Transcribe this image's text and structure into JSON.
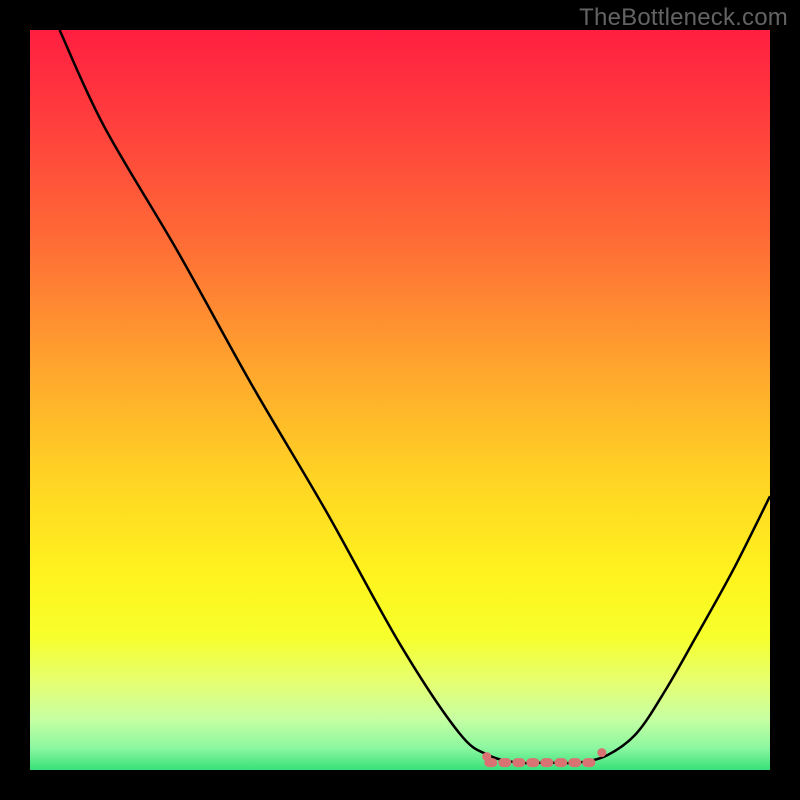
{
  "watermark": "TheBottleneck.com",
  "chart_data": {
    "type": "line",
    "title": "",
    "xlabel": "",
    "ylabel": "",
    "xlim": [
      0,
      100
    ],
    "ylim": [
      0,
      100
    ],
    "grid": false,
    "series": [
      {
        "name": "curve",
        "color": "#000000",
        "x": [
          4,
          10,
          20,
          30,
          40,
          50,
          58,
          62,
          66,
          70,
          74,
          78,
          82,
          86,
          90,
          95,
          100
        ],
        "y": [
          100,
          87,
          70,
          52,
          35,
          17,
          5,
          2,
          1,
          1,
          1,
          2,
          5,
          11,
          18,
          27,
          37
        ]
      }
    ],
    "optimal_marker": {
      "color": "#d97373",
      "x_start": 62,
      "x_end": 77,
      "y": 1
    },
    "background_gradient": {
      "stops": [
        {
          "offset": 0.0,
          "color": "#ff1f41"
        },
        {
          "offset": 0.12,
          "color": "#ff3d3d"
        },
        {
          "offset": 0.28,
          "color": "#ff6a36"
        },
        {
          "offset": 0.45,
          "color": "#ffa32e"
        },
        {
          "offset": 0.6,
          "color": "#ffd224"
        },
        {
          "offset": 0.74,
          "color": "#fff41e"
        },
        {
          "offset": 0.82,
          "color": "#f6ff2c"
        },
        {
          "offset": 0.88,
          "color": "#e6ff70"
        },
        {
          "offset": 0.93,
          "color": "#c8ffa2"
        },
        {
          "offset": 0.97,
          "color": "#8cf7a0"
        },
        {
          "offset": 1.0,
          "color": "#38e07a"
        }
      ]
    }
  }
}
